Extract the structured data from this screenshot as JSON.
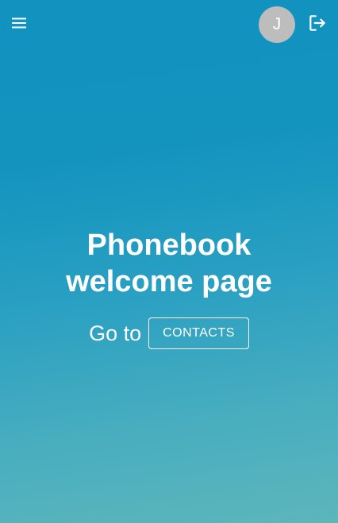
{
  "header": {
    "menu_icon": "menu-icon",
    "avatar_initial": "J",
    "logout_icon": "logout-icon"
  },
  "hero": {
    "title_line1": "Phonebook",
    "title_line2": "welcome page",
    "goto_text": "Go to",
    "contacts_button_label": "CONTACTS"
  },
  "colors": {
    "gradient_top": "#1292bf",
    "gradient_bottom": "#5cb6bb",
    "avatar_bg": "#bdbdbd",
    "text": "#ffffff"
  }
}
